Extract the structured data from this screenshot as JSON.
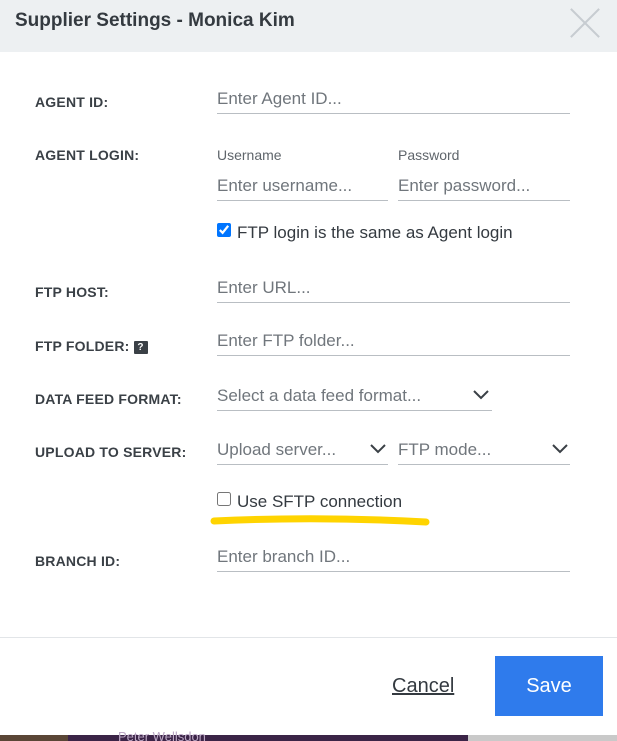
{
  "dialog": {
    "title": "Supplier Settings - Monica Kim"
  },
  "form": {
    "agent_id": {
      "label": "AGENT ID:",
      "placeholder": "Enter Agent ID..."
    },
    "agent_login": {
      "label": "AGENT LOGIN:",
      "username_label": "Username",
      "username_placeholder": "Enter username...",
      "password_label": "Password",
      "password_placeholder": "Enter password..."
    },
    "ftp_same_login": {
      "label": "FTP login is the same as Agent login",
      "checked": true
    },
    "ftp_host": {
      "label": "FTP HOST:",
      "placeholder": "Enter URL..."
    },
    "ftp_folder": {
      "label": "FTP FOLDER:",
      "placeholder": "Enter FTP folder...",
      "help_icon": "help-icon"
    },
    "data_feed_format": {
      "label": "DATA FEED FORMAT:",
      "selected": "Select a data feed format..."
    },
    "upload_to_server": {
      "label": "UPLOAD TO SERVER:",
      "server_selected": "Upload server...",
      "mode_selected": "FTP mode..."
    },
    "use_sftp": {
      "label": "Use SFTP connection",
      "checked": false,
      "highlight_color": "#ffd400"
    },
    "branch_id": {
      "label": "BRANCH ID:",
      "placeholder": "Enter branch ID..."
    }
  },
  "footer": {
    "cancel_label": "Cancel",
    "save_label": "Save"
  },
  "background": {
    "partial_text": "Peter Wellsdon"
  },
  "colors": {
    "header_bg": "#edf0f2",
    "save_button": "#2f7bec",
    "label_text": "#3a4046"
  }
}
